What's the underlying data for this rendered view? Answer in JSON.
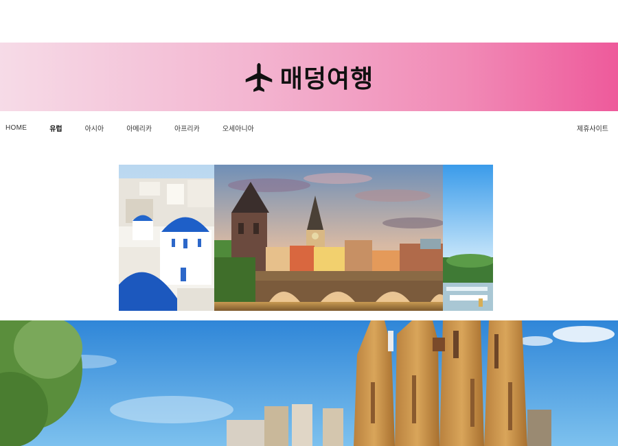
{
  "header": {
    "logo_icon": "airplane-icon",
    "brand_name": "매덩여행",
    "gradient_colors": [
      "#f6dbe7",
      "#f3b6d1",
      "#f18ab6",
      "#ee5a9b"
    ]
  },
  "nav": {
    "items": [
      {
        "label": "HOME"
      },
      {
        "label": "유럽",
        "active": true
      },
      {
        "label": "아시아"
      },
      {
        "label": "아메리카"
      },
      {
        "label": "아프리카"
      },
      {
        "label": "오세아니아"
      }
    ],
    "partner_link": "제휴사이트"
  },
  "gallery": {
    "slides": [
      "santorini-photo",
      "prague-charles-bridge-photo",
      "fountain-sky-photo"
    ]
  },
  "hero": {
    "image": "sagrada-familia-photo"
  }
}
